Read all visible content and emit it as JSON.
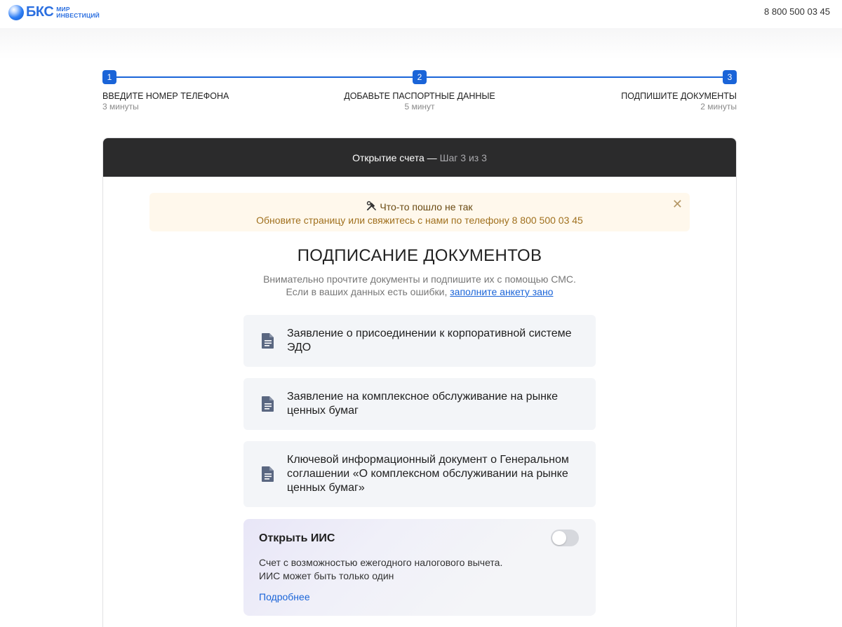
{
  "header": {
    "logo_word": "БКС",
    "logo_sub_1": "МИР",
    "logo_sub_2": "ИНВЕСТИЦИЙ",
    "phone": "8 800 500 03 45"
  },
  "stepper": {
    "steps": [
      {
        "number": "1",
        "title": "Введите номер телефона",
        "time": "3 минуты"
      },
      {
        "number": "2",
        "title": "Добавьте паспортные данные",
        "time": "5 минут"
      },
      {
        "number": "3",
        "title": "Подпишите документы",
        "time": "2 минуты"
      }
    ]
  },
  "card": {
    "head_title": "Открытие счета —",
    "head_step": "Шаг 3 из 3"
  },
  "alert": {
    "title": "Что-то пошло не так",
    "message": "Обновите страницу или свяжитесь с нами по телефону 8 800 500 03 45",
    "close": "✕"
  },
  "documents": {
    "title": "ПОДПИСАНИЕ ДОКУМЕНТОВ",
    "subtitle_1": "Внимательно прочтите документы и подпишите их с помощью СМС.",
    "subtitle_2": "Если в ваших данных есть ошибки,",
    "subtitle_link": "заполните анкету зано",
    "items": [
      {
        "label": "Заявление о присоединении к корпоративной системе ЭДО"
      },
      {
        "label": "Заявление на комплексное обслуживание на рынке ценных бумаг"
      },
      {
        "label": "Ключевой информационный документ о Генеральном соглашении «О комплексном обслуживании на рынке ценных бумаг»"
      }
    ]
  },
  "iis": {
    "title": "Открыть ИИС",
    "text_1": "Счет с возможностью ежегодного налогового вычета.",
    "text_2": "ИИС может быть только один",
    "link": "Подробнее",
    "toggle_on": false
  },
  "colors": {
    "accent": "#1a64d8",
    "header_dark": "#2b2b2c",
    "alert_bg": "#fff8ec",
    "doc_bg": "#f3f5f8"
  }
}
